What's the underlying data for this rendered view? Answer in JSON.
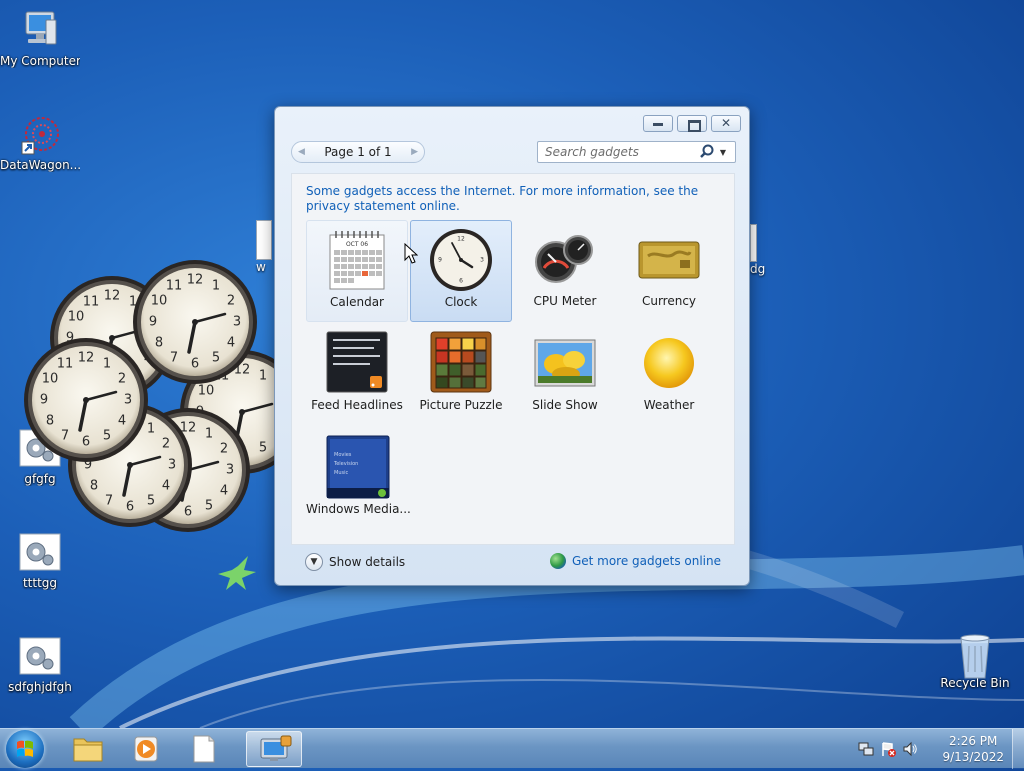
{
  "desktop": {
    "icons": [
      {
        "label": "My Computer"
      },
      {
        "label": "DataWagon..."
      },
      {
        "label": "gfgfg"
      },
      {
        "label": "ttttgg"
      },
      {
        "label": "sdfghjdfgh"
      },
      {
        "label": "Recycle Bin"
      }
    ],
    "partial_labels": {
      "left": "w",
      "right": "dg"
    }
  },
  "gadget_window": {
    "pager_label": "Page 1 of 1",
    "search_placeholder": "Search gadgets",
    "notice": "Some gadgets access the Internet.  For more information, see the privacy statement online.",
    "gadgets": [
      {
        "label": "Calendar",
        "icon": "calendar-icon",
        "state": "hover"
      },
      {
        "label": "Clock",
        "icon": "clock-icon",
        "state": "selected"
      },
      {
        "label": "CPU Meter",
        "icon": "cpu-meter-icon"
      },
      {
        "label": "Currency",
        "icon": "currency-icon"
      },
      {
        "label": "Feed Headlines",
        "icon": "feed-headlines-icon"
      },
      {
        "label": "Picture Puzzle",
        "icon": "picture-puzzle-icon"
      },
      {
        "label": "Slide Show",
        "icon": "slide-show-icon"
      },
      {
        "label": "Weather",
        "icon": "weather-icon"
      },
      {
        "label": "Windows Media...",
        "icon": "windows-media-center-icon"
      }
    ],
    "calendar_month": "OCT 06",
    "media_menu": [
      "Movies",
      "Television",
      "Music"
    ],
    "show_details_label": "Show details",
    "get_more_label": "Get more gadgets online"
  },
  "taskbar": {
    "time": "2:26 PM",
    "date": "9/13/2022"
  },
  "colors": {
    "link": "#1060b8",
    "selection": "#c9dcf3"
  }
}
